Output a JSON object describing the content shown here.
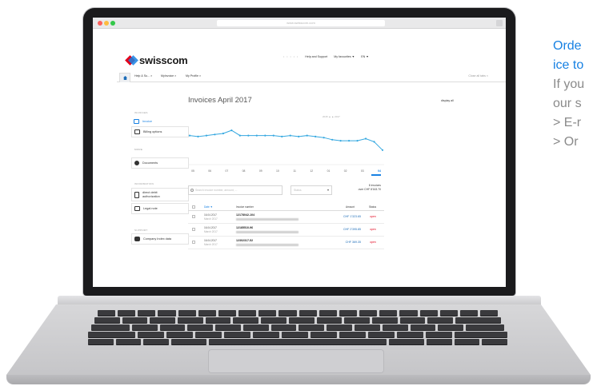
{
  "browser": {
    "url": "www.swisscom.com"
  },
  "header": {
    "logo_text": "swisscom",
    "links": {
      "faint": "• • • • •",
      "help": "Help and Support",
      "favourites": "My favourites ▼",
      "lang": "EN ▼"
    }
  },
  "tabs": {
    "items": [
      "Help & Su... ×",
      "MyInvoice ×",
      "My Profile ×"
    ],
    "close_all": "Close all tabs ×"
  },
  "sidebar": {
    "sections": {
      "invoices": "INVOICES",
      "more": "MORE",
      "information": "INFORMATION",
      "support": "SUPPORT"
    },
    "items": {
      "invoice": "Invoice",
      "billing": "Billing options",
      "documents": "Documents",
      "direct_debit": "direct debit authorization",
      "legal": "Legal note",
      "company": "Company Index data"
    }
  },
  "main": {
    "title": "Invoices April 2017",
    "display_all": "display all",
    "legend": "2015 ▲ ▲ 2017"
  },
  "chart_data": {
    "type": "line",
    "categories": [
      "05",
      "06",
      "07",
      "08",
      "09",
      "10",
      "11",
      "12",
      "01",
      "02",
      "03",
      "04",
      "05",
      "06",
      "07",
      "08",
      "09",
      "10",
      "11",
      "12",
      "01",
      "02",
      "03",
      "04"
    ],
    "x_labels_visible": [
      "05",
      "06",
      "07",
      "08",
      "09",
      "10",
      "11",
      "12",
      "01",
      "02",
      "03",
      "04"
    ],
    "values": [
      118,
      117,
      118,
      119,
      120,
      123,
      118,
      118,
      118,
      118,
      118,
      117,
      118,
      117,
      118,
      117,
      116,
      114,
      113,
      113,
      113,
      115,
      112,
      104
    ],
    "ylim": [
      90,
      130
    ],
    "color": "#35a8e0",
    "selected": "04"
  },
  "filters": {
    "search_placeholder": "Search invoice number, amount, ...",
    "status_placeholder": "Status",
    "count_line1": "8 invoices",
    "count_line2": "over CHF 8'163.70"
  },
  "table": {
    "headers": {
      "date": "Date ▼",
      "number": "Invoice number",
      "amount": "Amount",
      "status": "Status"
    },
    "rows": [
      {
        "date": "16.04.2017",
        "period": "March 2017",
        "number": "12178042-104",
        "amount": "CHF 1'323.65",
        "status": "open"
      },
      {
        "date": "16.04.2017",
        "period": "March 2017",
        "number": "12185510-96",
        "amount": "CHF 2'395.85",
        "status": "open"
      },
      {
        "date": "16.04.2017",
        "period": "March 2017",
        "number": "12302317-52",
        "amount": "CHF 369.35",
        "status": "open"
      }
    ]
  },
  "marketing": {
    "line1": "Orde",
    "line2": "ice to",
    "line3": "If you",
    "line4": "our s",
    "line5": "> E-r",
    "line6": "> Or"
  },
  "colors": {
    "brand_blue": "#1781e3",
    "brand_red": "#e2001a",
    "chart_line": "#35a8e0"
  }
}
